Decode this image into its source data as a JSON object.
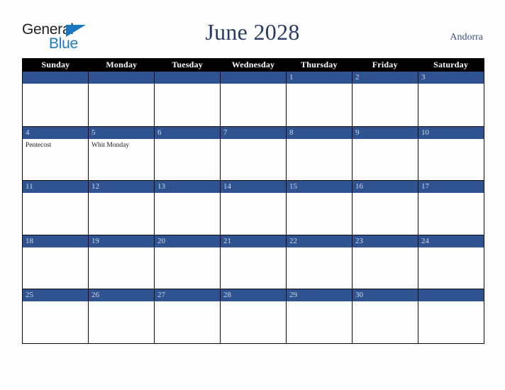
{
  "brand": {
    "name_top": "General",
    "name_bottom": "Blue",
    "triangle_color": "#1b7abf",
    "text_color": "#231f20"
  },
  "header": {
    "title": "June 2028",
    "locale": "Andorra",
    "title_color": "#2b3c62",
    "locale_color": "#3c5280"
  },
  "theme": {
    "band_blue": "#2e5390",
    "dow_bar": "#000000",
    "day_number_color": "#d5dae4",
    "page_background": "#fdfdfd",
    "grid_line": "#0a0a0a"
  },
  "calendar": {
    "month": "June",
    "year": "2028",
    "weekday_headers": [
      "Sunday",
      "Monday",
      "Tuesday",
      "Wednesday",
      "Thursday",
      "Friday",
      "Saturday"
    ],
    "weeks": [
      [
        {
          "date": "",
          "events": []
        },
        {
          "date": "",
          "events": []
        },
        {
          "date": "",
          "events": []
        },
        {
          "date": "",
          "events": []
        },
        {
          "date": "1",
          "events": []
        },
        {
          "date": "2",
          "events": []
        },
        {
          "date": "3",
          "events": []
        }
      ],
      [
        {
          "date": "4",
          "events": [
            "Pentecost"
          ]
        },
        {
          "date": "5",
          "events": [
            "Whit Monday"
          ]
        },
        {
          "date": "6",
          "events": []
        },
        {
          "date": "7",
          "events": []
        },
        {
          "date": "8",
          "events": []
        },
        {
          "date": "9",
          "events": []
        },
        {
          "date": "10",
          "events": []
        }
      ],
      [
        {
          "date": "11",
          "events": []
        },
        {
          "date": "12",
          "events": []
        },
        {
          "date": "13",
          "events": []
        },
        {
          "date": "14",
          "events": []
        },
        {
          "date": "15",
          "events": []
        },
        {
          "date": "16",
          "events": []
        },
        {
          "date": "17",
          "events": []
        }
      ],
      [
        {
          "date": "18",
          "events": []
        },
        {
          "date": "19",
          "events": []
        },
        {
          "date": "20",
          "events": []
        },
        {
          "date": "21",
          "events": []
        },
        {
          "date": "22",
          "events": []
        },
        {
          "date": "23",
          "events": []
        },
        {
          "date": "24",
          "events": []
        }
      ],
      [
        {
          "date": "25",
          "events": []
        },
        {
          "date": "26",
          "events": []
        },
        {
          "date": "27",
          "events": []
        },
        {
          "date": "28",
          "events": []
        },
        {
          "date": "29",
          "events": []
        },
        {
          "date": "30",
          "events": []
        },
        {
          "date": "",
          "events": []
        }
      ]
    ]
  }
}
